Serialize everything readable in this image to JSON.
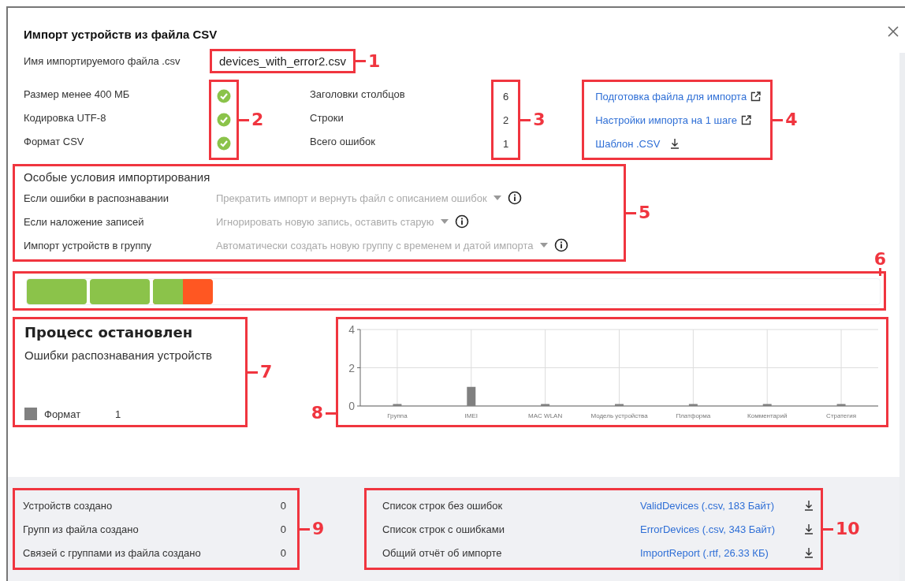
{
  "dialog": {
    "title": "Импорт устройств из файла CSV"
  },
  "file": {
    "callout": "1",
    "label": "Имя импортируемого файла .csv",
    "value": "devices_with_error2.csv"
  },
  "checks": {
    "callout": "2",
    "items": [
      {
        "label": "Размер менее 400 МБ",
        "passed": true
      },
      {
        "label": "Кодировка UTF-8",
        "passed": true
      },
      {
        "label": "Формат CSV",
        "passed": true
      }
    ]
  },
  "stats": {
    "callout": "3",
    "items": [
      {
        "label": "Заголовки столбцов",
        "value": "6"
      },
      {
        "label": "Строки",
        "value": "2"
      },
      {
        "label": "Всего ошибок",
        "value": "1"
      }
    ]
  },
  "links": {
    "callout": "4",
    "items": [
      {
        "label": "Подготовка файла для импорта",
        "kind": "external"
      },
      {
        "label": "Настройки импорта на 1 шаге",
        "kind": "external"
      },
      {
        "label": "Шаблон .CSV",
        "kind": "download"
      }
    ]
  },
  "conditions": {
    "callout": "5",
    "title": "Особые условия импортирования",
    "items": [
      {
        "label": "Если ошибки в распознавании",
        "value": "Прекратить импорт и вернуть файл с описанием ошибок"
      },
      {
        "label": "Если наложение записей",
        "value": "Игнорировать новую запись, оставить старую"
      },
      {
        "label": "Импорт устройств в группу",
        "value": "Автоматически создать новую группу с временем и датой импорта"
      }
    ]
  },
  "progress": {
    "callout": "6",
    "segments": [
      {
        "level": 1
      },
      {
        "level": 1
      },
      {
        "level": 0.5
      }
    ]
  },
  "status": {
    "callout": "7",
    "title": "Процесс остановлен",
    "subtitle": "Ошибки распознавания устройств",
    "legend": [
      {
        "label": "Формат",
        "value": "1",
        "color": "#808080"
      }
    ]
  },
  "chart": {
    "callout": "8",
    "chart_data": {
      "type": "bar",
      "categories": [
        "Группа",
        "IMEI",
        "MAC WLAN",
        "Модель устройства",
        "Платформа",
        "Комментарий",
        "Стратегия"
      ],
      "values": [
        0,
        1,
        0,
        0,
        0,
        0,
        0
      ],
      "ylim": [
        0,
        4
      ],
      "yticks": [
        0,
        2,
        4
      ],
      "grid": true
    }
  },
  "summary": {
    "callout": "9",
    "items": [
      {
        "label": "Устройств создано",
        "value": "0"
      },
      {
        "label": "Групп из файла создано",
        "value": "0"
      },
      {
        "label": "Связей с группами из файла создано",
        "value": "0"
      }
    ]
  },
  "reports": {
    "callout": "10",
    "items": [
      {
        "label": "Список строк без ошибок",
        "link": "ValidDevices (.csv, 183 Байт)"
      },
      {
        "label": "Список строк с ошибками",
        "link": "ErrorDevices (.csv, 343 Байт)"
      },
      {
        "label": "Общий отчёт об импорте",
        "link": "ImportReport (.rtf, 26.33 КБ)"
      }
    ]
  }
}
